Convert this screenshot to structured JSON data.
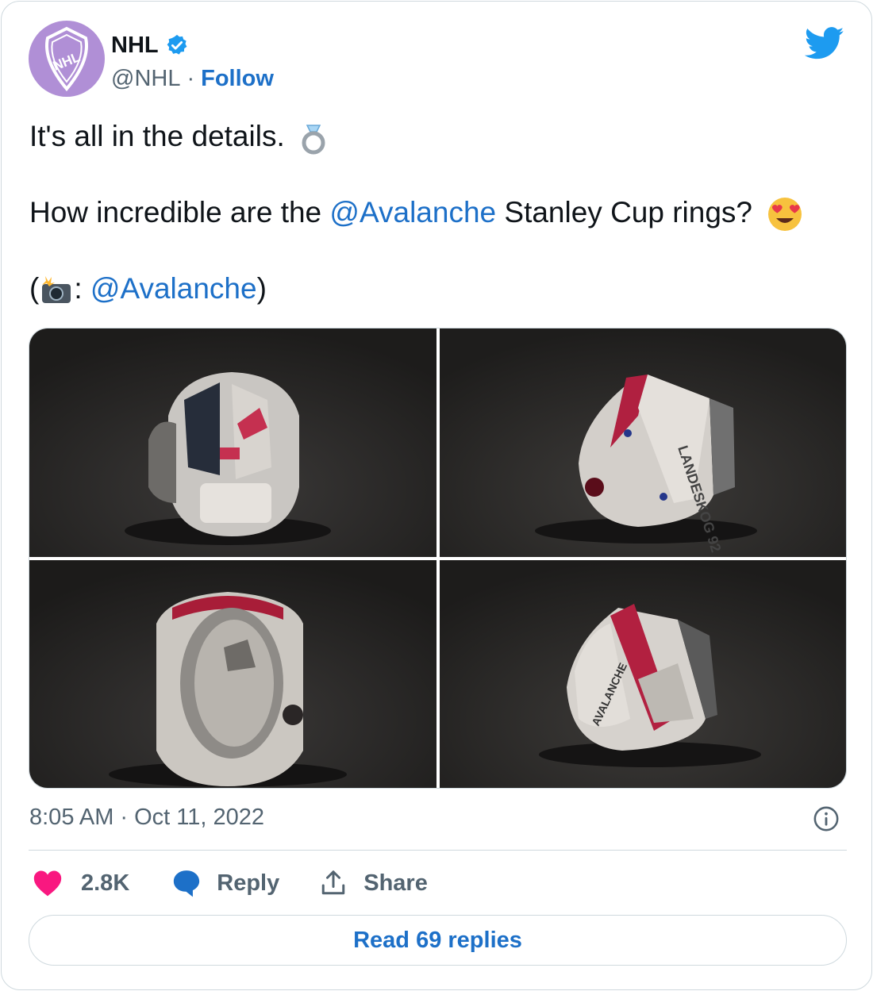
{
  "author": {
    "name": "NHL",
    "handle": "@NHL",
    "separator": "·",
    "follow_label": "Follow",
    "avatar_logo_text": "NHL"
  },
  "tweet": {
    "line1": {
      "text": "It's all in the details.",
      "emoji": "ring"
    },
    "line2": {
      "prefix": "How incredible are the ",
      "mention": "@Avalanche",
      "suffix": " Stanley Cup rings?",
      "emoji": "smiling-face-with-heart-eyes"
    },
    "line3": {
      "open": "(",
      "emoji": "camera-with-flash",
      "colon": ": ",
      "mention": "@Avalanche",
      "close": ")"
    }
  },
  "media": {
    "photos": [
      {
        "label": "Ring front view",
        "text_on_ring": ""
      },
      {
        "label": "Ring side view",
        "text_on_ring": "LANDESKOG 92"
      },
      {
        "label": "Ring inside view",
        "text_on_ring": ""
      },
      {
        "label": "Ring side view 2",
        "text_on_ring": "AVALANCHE"
      }
    ]
  },
  "footer": {
    "time": "8:05 AM",
    "separator": "·",
    "date": "Oct 11, 2022",
    "likes": "2.8K",
    "reply_label": "Reply",
    "share_label": "Share",
    "read_replies_label": "Read 69 replies"
  },
  "colors": {
    "link": "#1d70c8",
    "twitter_blue": "#1d9bf0",
    "like_red": "#f91880",
    "muted": "#536471",
    "avatar_purple": "#b08fd6"
  }
}
